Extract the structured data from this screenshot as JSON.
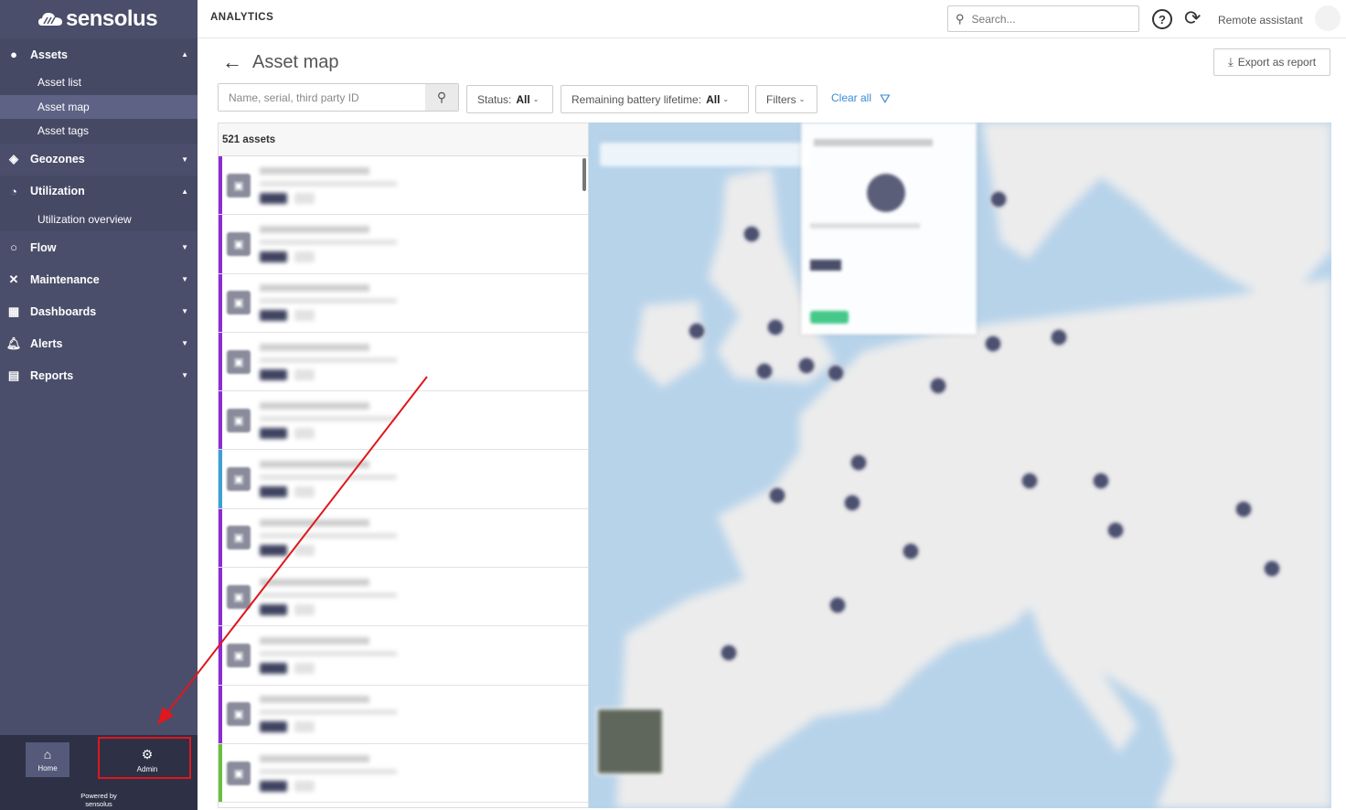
{
  "sidebar": {
    "brand": "sensolus",
    "groups": [
      {
        "label": "Assets",
        "icon": "assets-icon",
        "open": true,
        "subitems": [
          "Asset list",
          "Asset map",
          "Asset tags"
        ]
      },
      {
        "label": "Geozones",
        "icon": "geozones-icon"
      },
      {
        "label": "Utilization",
        "icon": "utilization-icon",
        "open": true,
        "subitems": [
          "Utilization overview"
        ]
      },
      {
        "label": "Flow",
        "icon": "flow-icon"
      },
      {
        "label": "Maintenance",
        "icon": "maintenance-icon"
      },
      {
        "label": "Dashboards",
        "icon": "dashboards-icon"
      },
      {
        "label": "Alerts",
        "icon": "bell-icon"
      },
      {
        "label": "Reports",
        "icon": "reports-icon"
      }
    ],
    "active_subitem": "Asset map",
    "bottom": {
      "home_label": "Home",
      "admin_label": "Admin",
      "powered_by": "Powered by",
      "powered_brand": "sensolus"
    }
  },
  "topbar": {
    "section": "ANALYTICS",
    "search_placeholder": "Search...",
    "remote_assistant": "Remote assistant"
  },
  "page": {
    "title": "Asset map",
    "export_label": "Export as report"
  },
  "filters": {
    "search_placeholder": "Name, serial, third party ID",
    "status_label": "Status:",
    "status_value": "All",
    "battery_label": "Remaining battery lifetime:",
    "battery_value": "All",
    "filters_label": "Filters",
    "clear_all": "Clear all"
  },
  "list": {
    "count_label": "521 assets",
    "row_colors": [
      "#8e2bd8",
      "#8e2bd8",
      "#8e2bd8",
      "#8e2bd8",
      "#8e2bd8",
      "#3aa0d8",
      "#8e2bd8",
      "#8e2bd8",
      "#8e2bd8",
      "#8e2bd8",
      "#68c03c"
    ]
  },
  "colors": {
    "sidebar_bg": "#4a4e6a",
    "accent": "#3d8bd6",
    "annotation": "#e0171d"
  }
}
